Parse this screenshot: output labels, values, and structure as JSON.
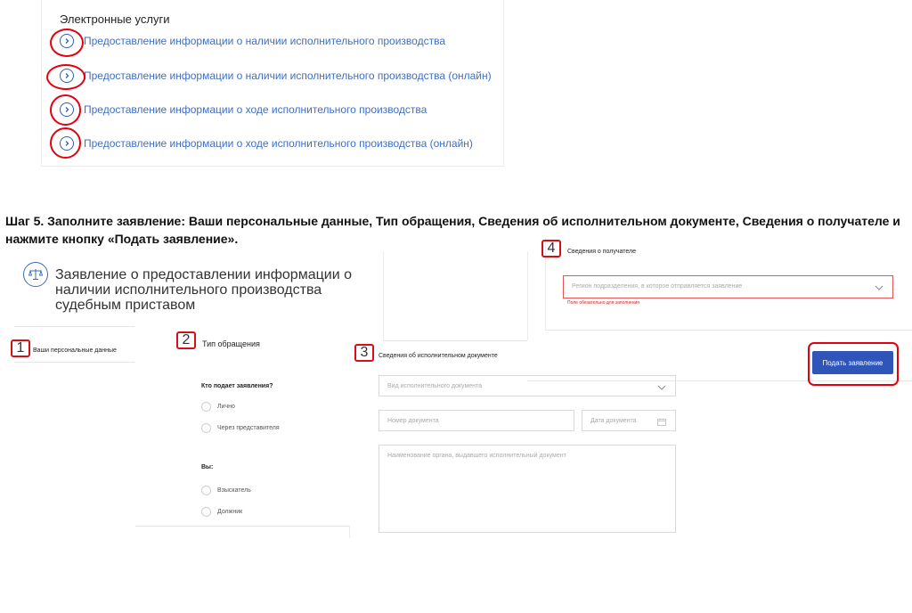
{
  "services": {
    "title": "Электронные услуги",
    "items": [
      {
        "label": "Предоставление информации о наличии исполнительного производства"
      },
      {
        "label": "Предоставление информации о наличии исполнительного производства (онлайн)"
      },
      {
        "label": "Предоставление информации о ходе исполнительного производства"
      },
      {
        "label": "Предоставление информации о ходе исполнительного производства (онлайн)"
      }
    ]
  },
  "step_heading": "Шаг 5. Заполните заявление: Ваши персональные данные, Тип обращения, Сведения об исполнительном документе, Сведения о получателе и нажмите кнопку «Подать заявление».",
  "form": {
    "title": "Заявление о предоставлении информации о наличии исполнительного производства судебным приставом"
  },
  "sections": {
    "s1": {
      "num": "1",
      "label": "Ваши персональные данные"
    },
    "s2": {
      "num": "2",
      "label": "Тип обращения"
    },
    "s3": {
      "num": "3",
      "label": "Сведения об исполнительном документе"
    },
    "s4": {
      "num": "4",
      "label": "Сведения о получателе"
    }
  },
  "appeal": {
    "q1": "Кто подает заявления?",
    "q1_options": [
      "Лично",
      "Через представителя"
    ],
    "q2": "Вы:",
    "q2_options": [
      "Взыскатель",
      "Должник"
    ]
  },
  "document": {
    "type_placeholder": "Вид исполнительного документа",
    "number_placeholder": "Номер документа",
    "date_placeholder": "Дата документа",
    "issuer_placeholder": "Наименование органа, выдавшего исполнительный документ"
  },
  "recipient": {
    "region_placeholder": "Регион подразделения, в которое отправляется заявление",
    "required_error": "Поле обязательно для заполнения"
  },
  "submit_label": "Подать заявление",
  "colors": {
    "accent": "#2f55b8",
    "link": "#3f6fc4",
    "annotation_red": "#e3000f"
  }
}
